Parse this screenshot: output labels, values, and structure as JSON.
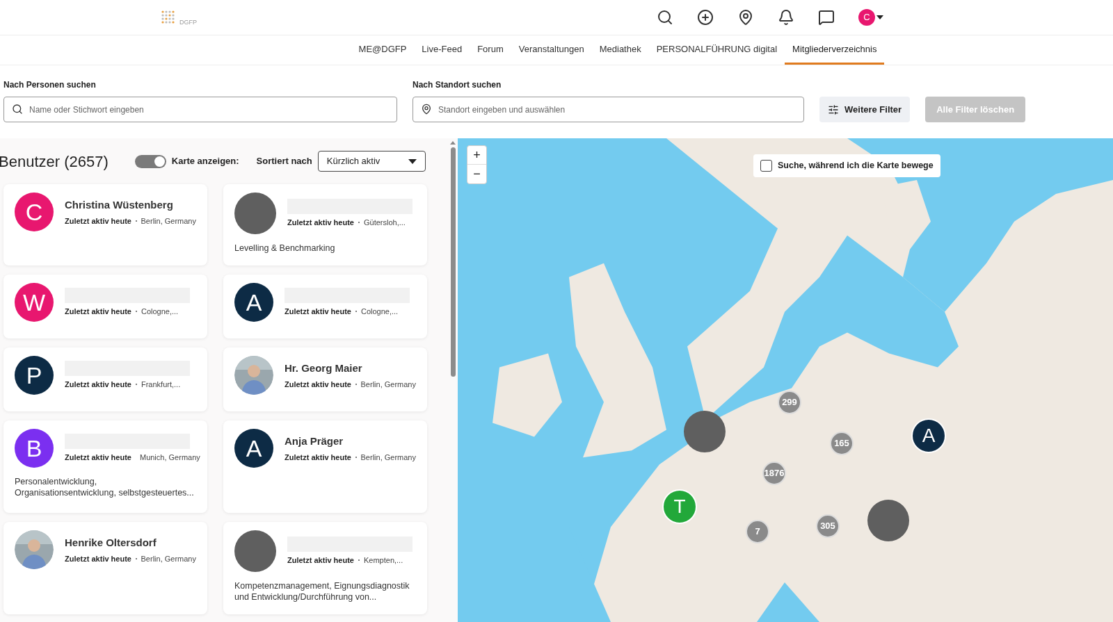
{
  "header": {
    "logo_text": "DGFP",
    "avatar_initial": "C"
  },
  "nav": [
    {
      "label": "ME@DGFP",
      "selected": false
    },
    {
      "label": "Live-Feed",
      "selected": false
    },
    {
      "label": "Forum",
      "selected": false
    },
    {
      "label": "Veranstaltungen",
      "selected": false
    },
    {
      "label": "Mediathek",
      "selected": false
    },
    {
      "label": "PERSONALFÜHRUNG digital",
      "selected": false
    },
    {
      "label": "Mitgliederverzeichnis",
      "selected": true
    }
  ],
  "search": {
    "person_label": "Nach Personen suchen",
    "person_placeholder": "Name oder Stichwort eingeben",
    "location_label": "Nach Standort suchen",
    "location_placeholder": "Standort eingeben und auswählen",
    "filter_button": "Weitere Filter",
    "clear_button": "Alle Filter löschen",
    "clear_disabled": true
  },
  "list": {
    "title": "Benutzer (2657)",
    "map_toggle_label": "Karte anzeigen:",
    "map_toggle_on": true,
    "sort_label": "Sortiert nach",
    "sort_value": "Kürzlich aktiv"
  },
  "users": [
    {
      "kind": "letter",
      "initial": "C",
      "color": "#e8176f",
      "name": "Christina Wüstenberg",
      "activity": "Zuletzt aktiv heute",
      "location": "Berlin, Germany"
    },
    {
      "kind": "blank",
      "activity": "Zuletzt aktiv heute",
      "location": "Gütersloh,...",
      "bio": "Levelling & Benchmarking"
    },
    {
      "kind": "letter",
      "initial": "W",
      "color": "#e8176f",
      "activity": "Zuletzt aktiv heute",
      "location": "Cologne,..."
    },
    {
      "kind": "letter",
      "initial": "A",
      "color": "#0d2b45",
      "activity": "Zuletzt aktiv heute",
      "location": "Cologne,..."
    },
    {
      "kind": "letter",
      "initial": "P",
      "color": "#0d2b45",
      "activity": "Zuletzt aktiv heute",
      "location": "Frankfurt,..."
    },
    {
      "name": "Hr. Georg Maier",
      "activity": "Zuletzt aktiv heute",
      "location": "Berlin, Germany"
    },
    {
      "kind": "letter",
      "initial": "B",
      "color": "#7b2ff0",
      "activity": "Zuletzt aktiv heute",
      "location": "Munich, Germany",
      "bio": "Personalentwicklung, Organisationsentwicklung, selbstgesteuertes..."
    },
    {
      "kind": "letter",
      "initial": "A",
      "color": "#0d2b45",
      "name": "Anja Präger",
      "activity": "Zuletzt aktiv heute",
      "location": "Berlin, Germany"
    },
    {
      "name": "Henrike Oltersdorf",
      "activity": "Zuletzt aktiv heute",
      "location": "Berlin, Germany"
    },
    {
      "kind": "blank",
      "activity": "Zuletzt aktiv heute",
      "location": "Kempten,...",
      "bio": "Kompetenzmanagement, Eignungsdiagnostik und Entwicklung/Durchführung von..."
    }
  ],
  "map": {
    "zoom_in": "+",
    "zoom_out": "−",
    "search_on_move_label": "Suche, während ich die Karte bewege",
    "search_on_move_checked": false,
    "markers": [
      {
        "kind": "cluster",
        "label": "299"
      },
      {
        "kind": "cluster",
        "label": "165"
      },
      {
        "kind": "cluster",
        "label": "1876"
      },
      {
        "kind": "cluster",
        "label": "305"
      },
      {
        "kind": "cluster",
        "label": "7"
      },
      {
        "kind": "blank"
      },
      {
        "kind": "blank"
      },
      {
        "kind": "letter",
        "label": "A",
        "color": "#0d2b45"
      },
      {
        "kind": "letter",
        "label": "T",
        "color": "#22a83a"
      }
    ]
  }
}
